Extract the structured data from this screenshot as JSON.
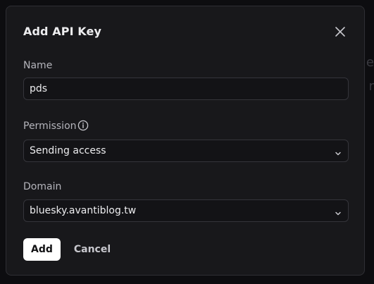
{
  "dialog": {
    "title": "Add API Key"
  },
  "form": {
    "name_label": "Name",
    "name_value": "pds",
    "permission_label": "Permission",
    "permission_value": "Sending access",
    "domain_label": "Domain",
    "domain_value": "bluesky.avantiblog.tw"
  },
  "actions": {
    "add_label": "Add",
    "cancel_label": "Cancel"
  },
  "icons": {
    "close": "close-icon",
    "info": "info-icon",
    "chevron": "chevron-down-icon"
  },
  "colors": {
    "background": "#18181b",
    "primary_button": "#ffffff",
    "text": "#ededef"
  }
}
